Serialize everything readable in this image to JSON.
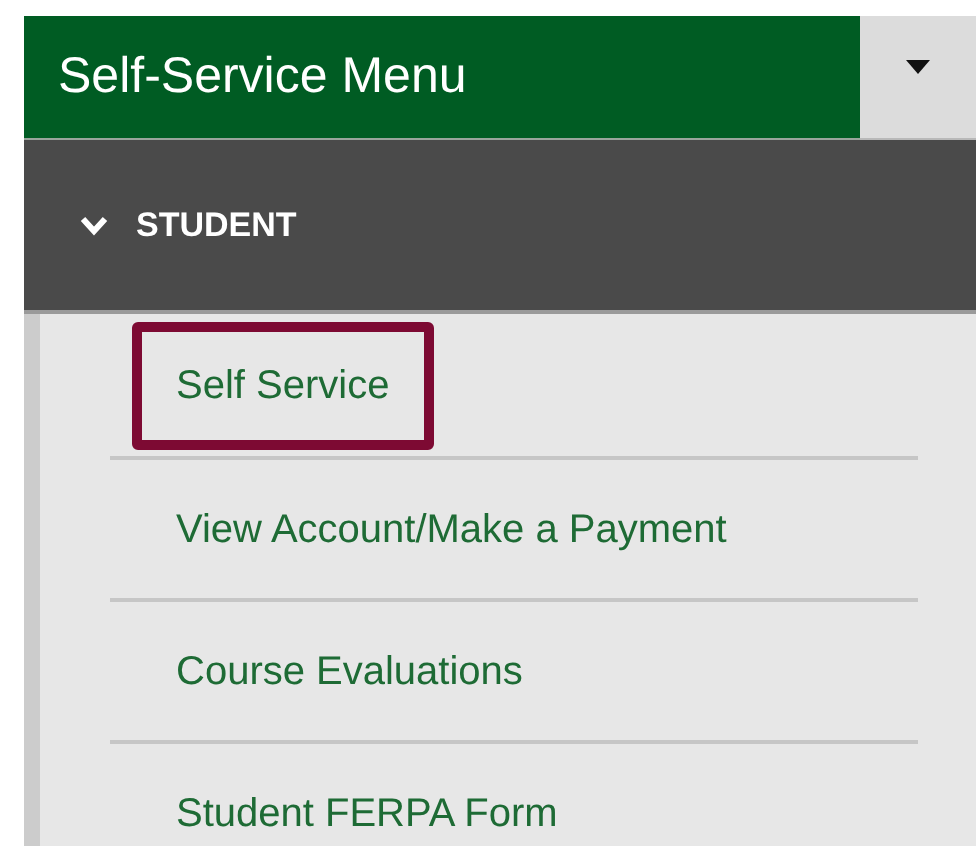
{
  "menu": {
    "title": "Self-Service Menu"
  },
  "section": {
    "label": "STUDENT",
    "expanded": true
  },
  "items": [
    {
      "label": "Self Service",
      "highlighted": true
    },
    {
      "label": "View Account/Make a Payment",
      "highlighted": false
    },
    {
      "label": "Course Evaluations",
      "highlighted": false
    },
    {
      "label": "Student FERPA Form",
      "highlighted": false
    }
  ]
}
